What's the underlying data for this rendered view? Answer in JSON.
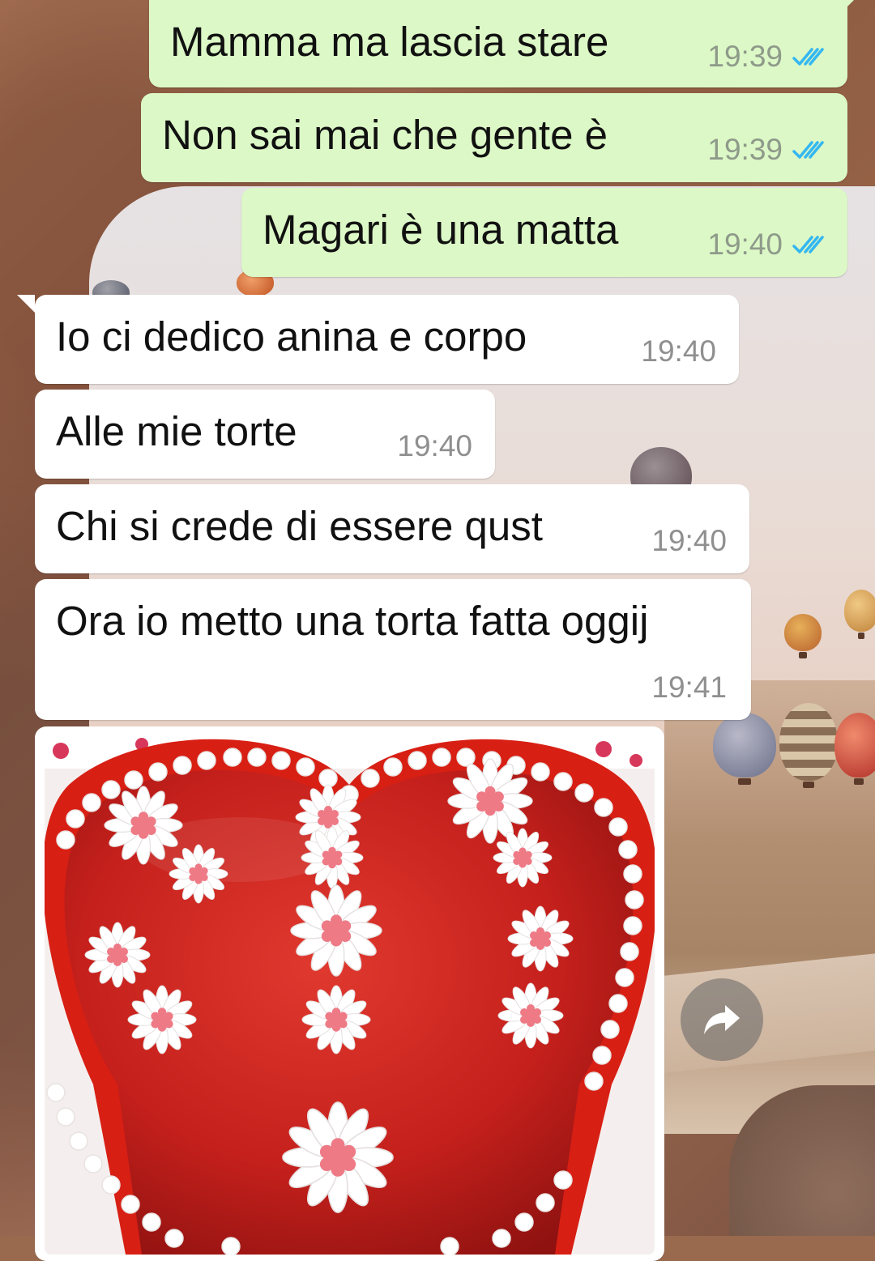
{
  "colors": {
    "outgoing_bubble": "#dcf8c6",
    "incoming_bubble": "#ffffff",
    "read_ticks": "#34b7f1"
  },
  "messages": [
    {
      "id": "m1",
      "direction": "outgoing",
      "text": "Mamma ma lascia stare",
      "time": "19:39",
      "status": "read"
    },
    {
      "id": "m2",
      "direction": "outgoing",
      "text": "Non sai mai che gente è",
      "time": "19:39",
      "status": "read"
    },
    {
      "id": "m3",
      "direction": "outgoing",
      "text": "Magari è una matta",
      "time": "19:40",
      "status": "read"
    },
    {
      "id": "m4",
      "direction": "incoming",
      "text": "Io ci dedico anina e corpo",
      "time": "19:40"
    },
    {
      "id": "m5",
      "direction": "incoming",
      "text": "Alle mie torte",
      "time": "19:40"
    },
    {
      "id": "m6",
      "direction": "incoming",
      "text": "Chi si crede di essere qust",
      "time": "19:40"
    },
    {
      "id": "m7",
      "direction": "incoming",
      "text": "Ora io metto una torta fatta oggij",
      "time": "19:41"
    }
  ],
  "image_message": {
    "direction": "incoming",
    "content": "heart-shaped red cake photo"
  },
  "icons": {
    "read_receipt": "double-check-icon",
    "forward": "forward-arrow-icon"
  }
}
